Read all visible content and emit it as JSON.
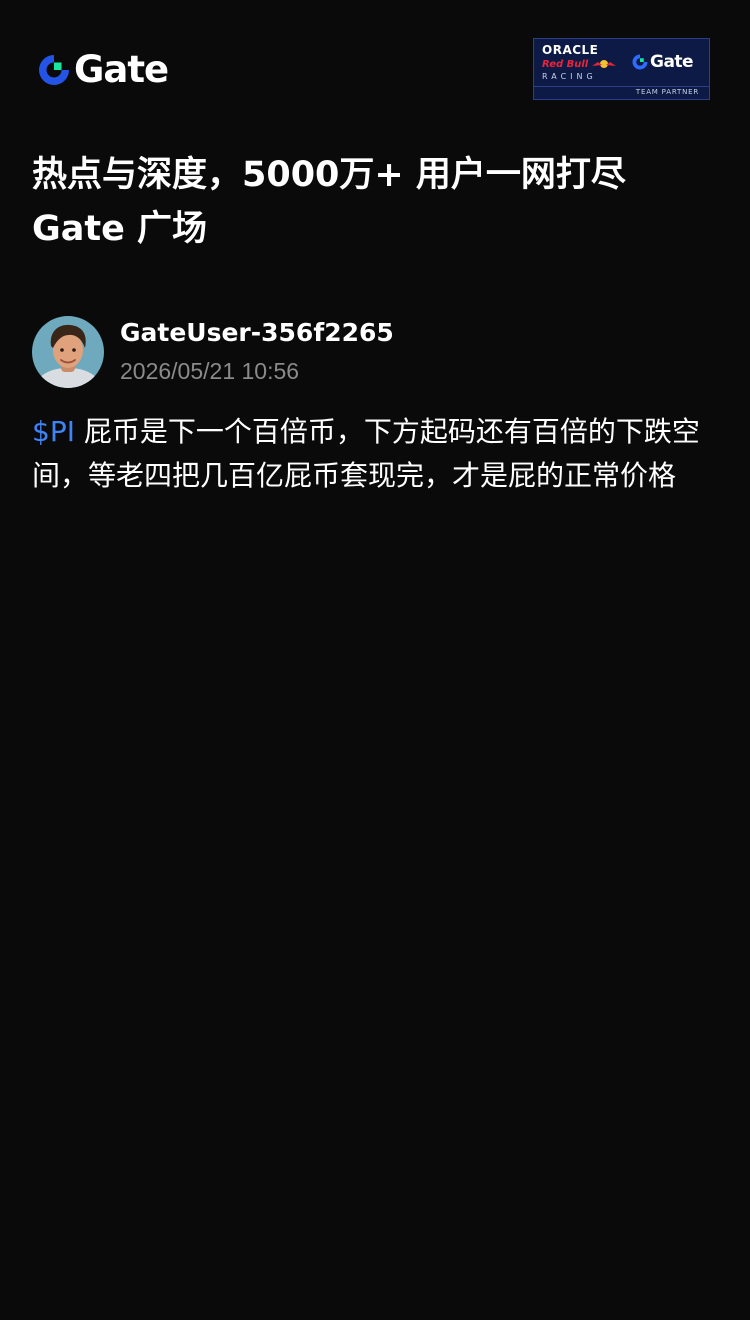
{
  "header": {
    "logo_text": "Gate",
    "brand_colors": {
      "logo_blue": "#2354e6",
      "logo_green": "#17e6a1",
      "ticker_blue": "#3e84f6",
      "badge_navy": "#0c1a45"
    },
    "partner_badge": {
      "oracle": "ORACLE",
      "red_bull": "Red Bull",
      "racing": "RACING",
      "gate": "Gate",
      "team_partner": "TEAM PARTNER"
    }
  },
  "headline": {
    "line1": "热点与深度，5000万+ 用户一网打尽",
    "line2": "Gate 广场"
  },
  "post": {
    "author": "GateUser-356f2265",
    "time": "2026/05/21 10:56",
    "ticker": "$PI",
    "body": " 屁币是下一个百倍币，下方起码还有百倍的下跌空间，等老四把几百亿屁币套现完，才是屁的正常价格"
  }
}
